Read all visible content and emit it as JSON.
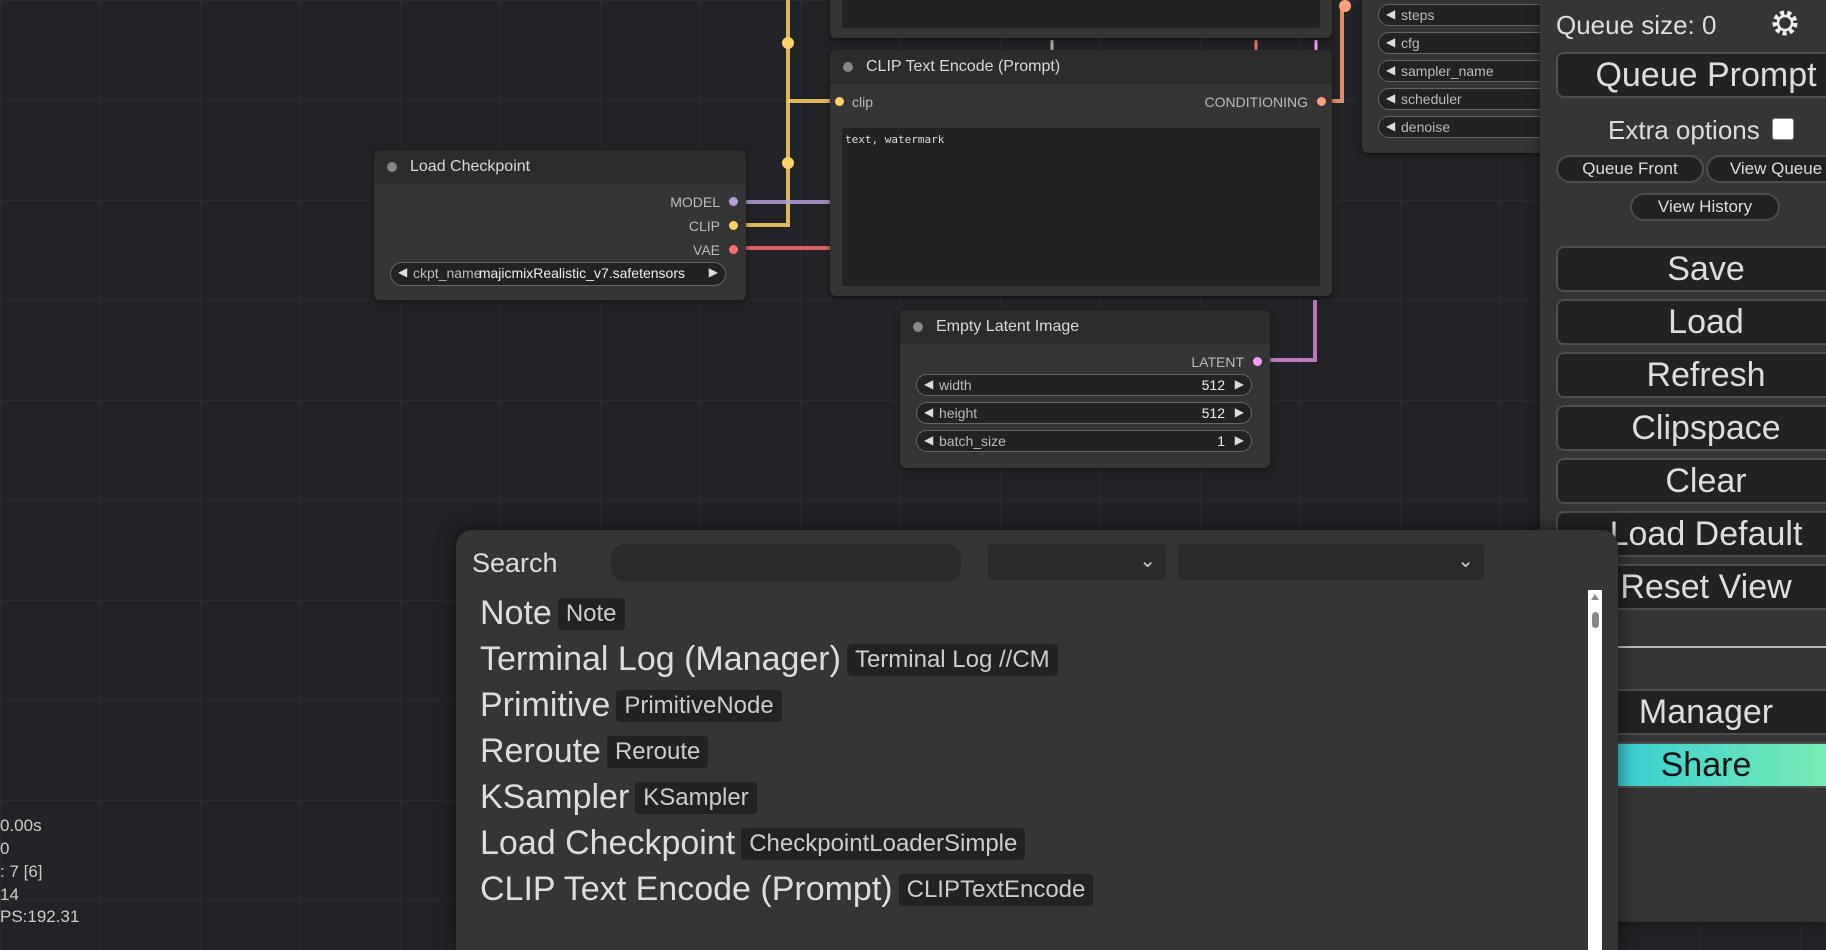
{
  "nodes": {
    "ksampler_partial": {
      "widgets": [
        {
          "label": "steps"
        },
        {
          "label": "cfg"
        },
        {
          "label": "sampler_name"
        },
        {
          "label": "scheduler"
        },
        {
          "label": "denoise"
        }
      ]
    },
    "clip_text_encode": {
      "title": "CLIP Text Encode (Prompt)",
      "input_clip": "clip",
      "output": "CONDITIONING",
      "text": "text, watermark"
    },
    "load_checkpoint": {
      "title": "Load Checkpoint",
      "outputs": [
        "MODEL",
        "CLIP",
        "VAE"
      ],
      "ckpt_label": "ckpt_name",
      "ckpt_value": "majicmixRealistic_v7.safetensors"
    },
    "empty_latent": {
      "title": "Empty Latent Image",
      "output": "LATENT",
      "widgets": [
        {
          "label": "width",
          "value": "512"
        },
        {
          "label": "height",
          "value": "512"
        },
        {
          "label": "batch_size",
          "value": "1"
        }
      ]
    }
  },
  "colors": {
    "model": "#b39ddb",
    "clip": "#ffd166",
    "vae": "#ff6e6e",
    "latent": "#ff9cf9",
    "conditioning": "#ffa07a"
  },
  "menu": {
    "queue_size": "Queue size: 0",
    "settings_icon": "gear-icon",
    "queue_prompt": "Queue Prompt",
    "extra_options": "Extra options",
    "queue_front": "Queue Front",
    "view_queue": "View Queue",
    "view_history": "View History",
    "save": "Save",
    "load": "Load",
    "refresh": "Refresh",
    "clipspace": "Clipspace",
    "clear": "Clear",
    "load_default": "Load Default",
    "reset_view": "Reset View",
    "manager": "Manager",
    "share": "Share"
  },
  "search": {
    "label": "Search",
    "value": "",
    "results": [
      {
        "name": "Note",
        "type": "Note"
      },
      {
        "name": "Terminal Log (Manager)",
        "type": "Terminal Log //CM"
      },
      {
        "name": "Primitive",
        "type": "PrimitiveNode"
      },
      {
        "name": "Reroute",
        "type": "Reroute"
      },
      {
        "name": "KSampler",
        "type": "KSampler"
      },
      {
        "name": "Load Checkpoint",
        "type": "CheckpointLoaderSimple"
      },
      {
        "name": "CLIP Text Encode (Prompt)",
        "type": "CLIPTextEncode"
      }
    ]
  },
  "stats": [
    "0.00s",
    "0",
    ": 7 [6]",
    "14",
    "PS:192.31"
  ]
}
